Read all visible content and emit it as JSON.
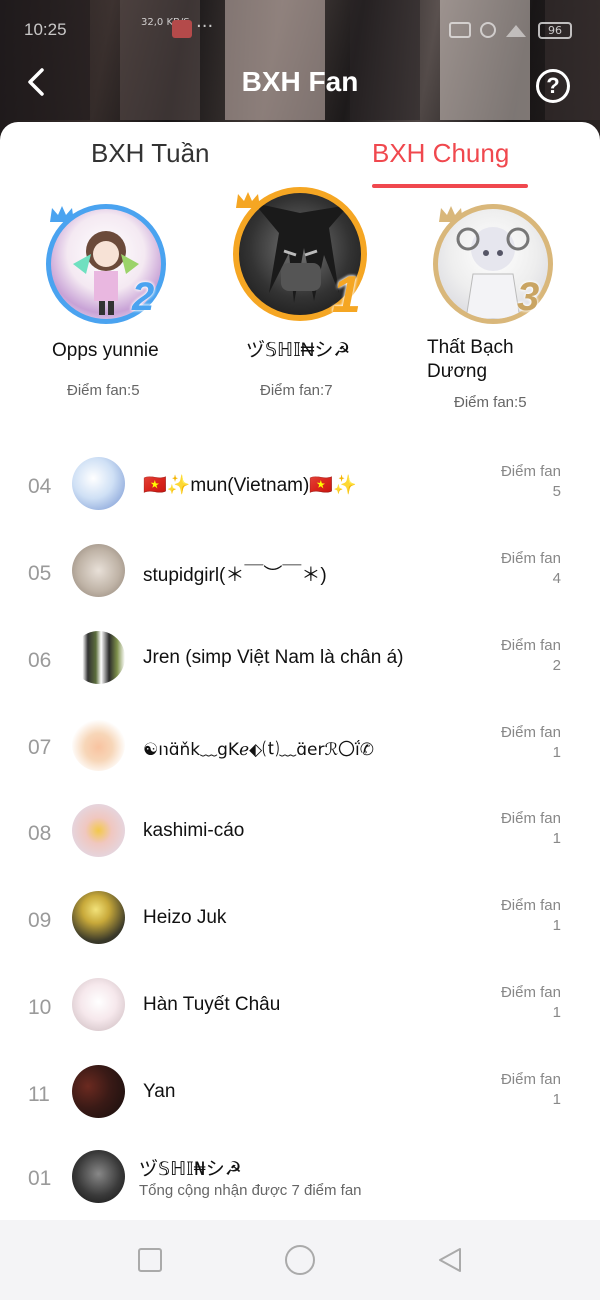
{
  "status": {
    "time": "10:25",
    "speed": "32,0 KB/S",
    "battery": "96"
  },
  "header": {
    "title": "BXH Fan",
    "back_icon": "chevron-left-icon",
    "help_icon": "question-circle-icon"
  },
  "tabs": [
    {
      "label": "BXH Tuần",
      "active": false
    },
    {
      "label": "BXH Chung",
      "active": true
    }
  ],
  "accent_color": "#f0484e",
  "podium": [
    {
      "rank": "2",
      "name": "Opps yunnie",
      "score_label": "Điểm fan:5",
      "ring_color": "#4aa3f0"
    },
    {
      "rank": "1",
      "name": "ヅ𝕊ℍ𝕀₦シ☭",
      "score_label": "Điểm fan:7",
      "ring_color": "#f5a623"
    },
    {
      "rank": "3",
      "name": "Thất Bạch Dương",
      "score_label": "Điểm fan:5",
      "ring_color": "#d9b77a"
    }
  ],
  "list": [
    {
      "rank": "04",
      "name": "🇻🇳✨mun(Vietnam)🇻🇳✨",
      "score_label": "Điểm fan",
      "score": "5"
    },
    {
      "rank": "05",
      "name": "stupidgirl(＊￣︶￣＊)",
      "score_label": "Điểm fan",
      "score": "4"
    },
    {
      "rank": "06",
      "name": "Jren (simp Việt Nam là chân á)",
      "score_label": "Điểm fan",
      "score": "2"
    },
    {
      "rank": "07",
      "name": "☯ı℩ɑ̈ňk﹏gKℯ⬖⒯﹏ɑ̈erℛ〇ḯ✆",
      "score_label": "Điểm fan",
      "score": "1"
    },
    {
      "rank": "08",
      "name": "kashimi-cáo",
      "score_label": "Điểm fan",
      "score": "1"
    },
    {
      "rank": "09",
      "name": "Heizo Juk",
      "score_label": "Điểm fan",
      "score": "1"
    },
    {
      "rank": "10",
      "name": "Hàn Tuyết Châu",
      "score_label": "Điểm fan",
      "score": "1"
    },
    {
      "rank": "11",
      "name": "Yan",
      "score_label": "Điểm fan",
      "score": "1"
    }
  ],
  "me": {
    "rank": "01",
    "name": "ヅ𝕊ℍ𝕀₦シ☭",
    "summary": "Tổng cộng nhận được 7 điểm fan"
  }
}
